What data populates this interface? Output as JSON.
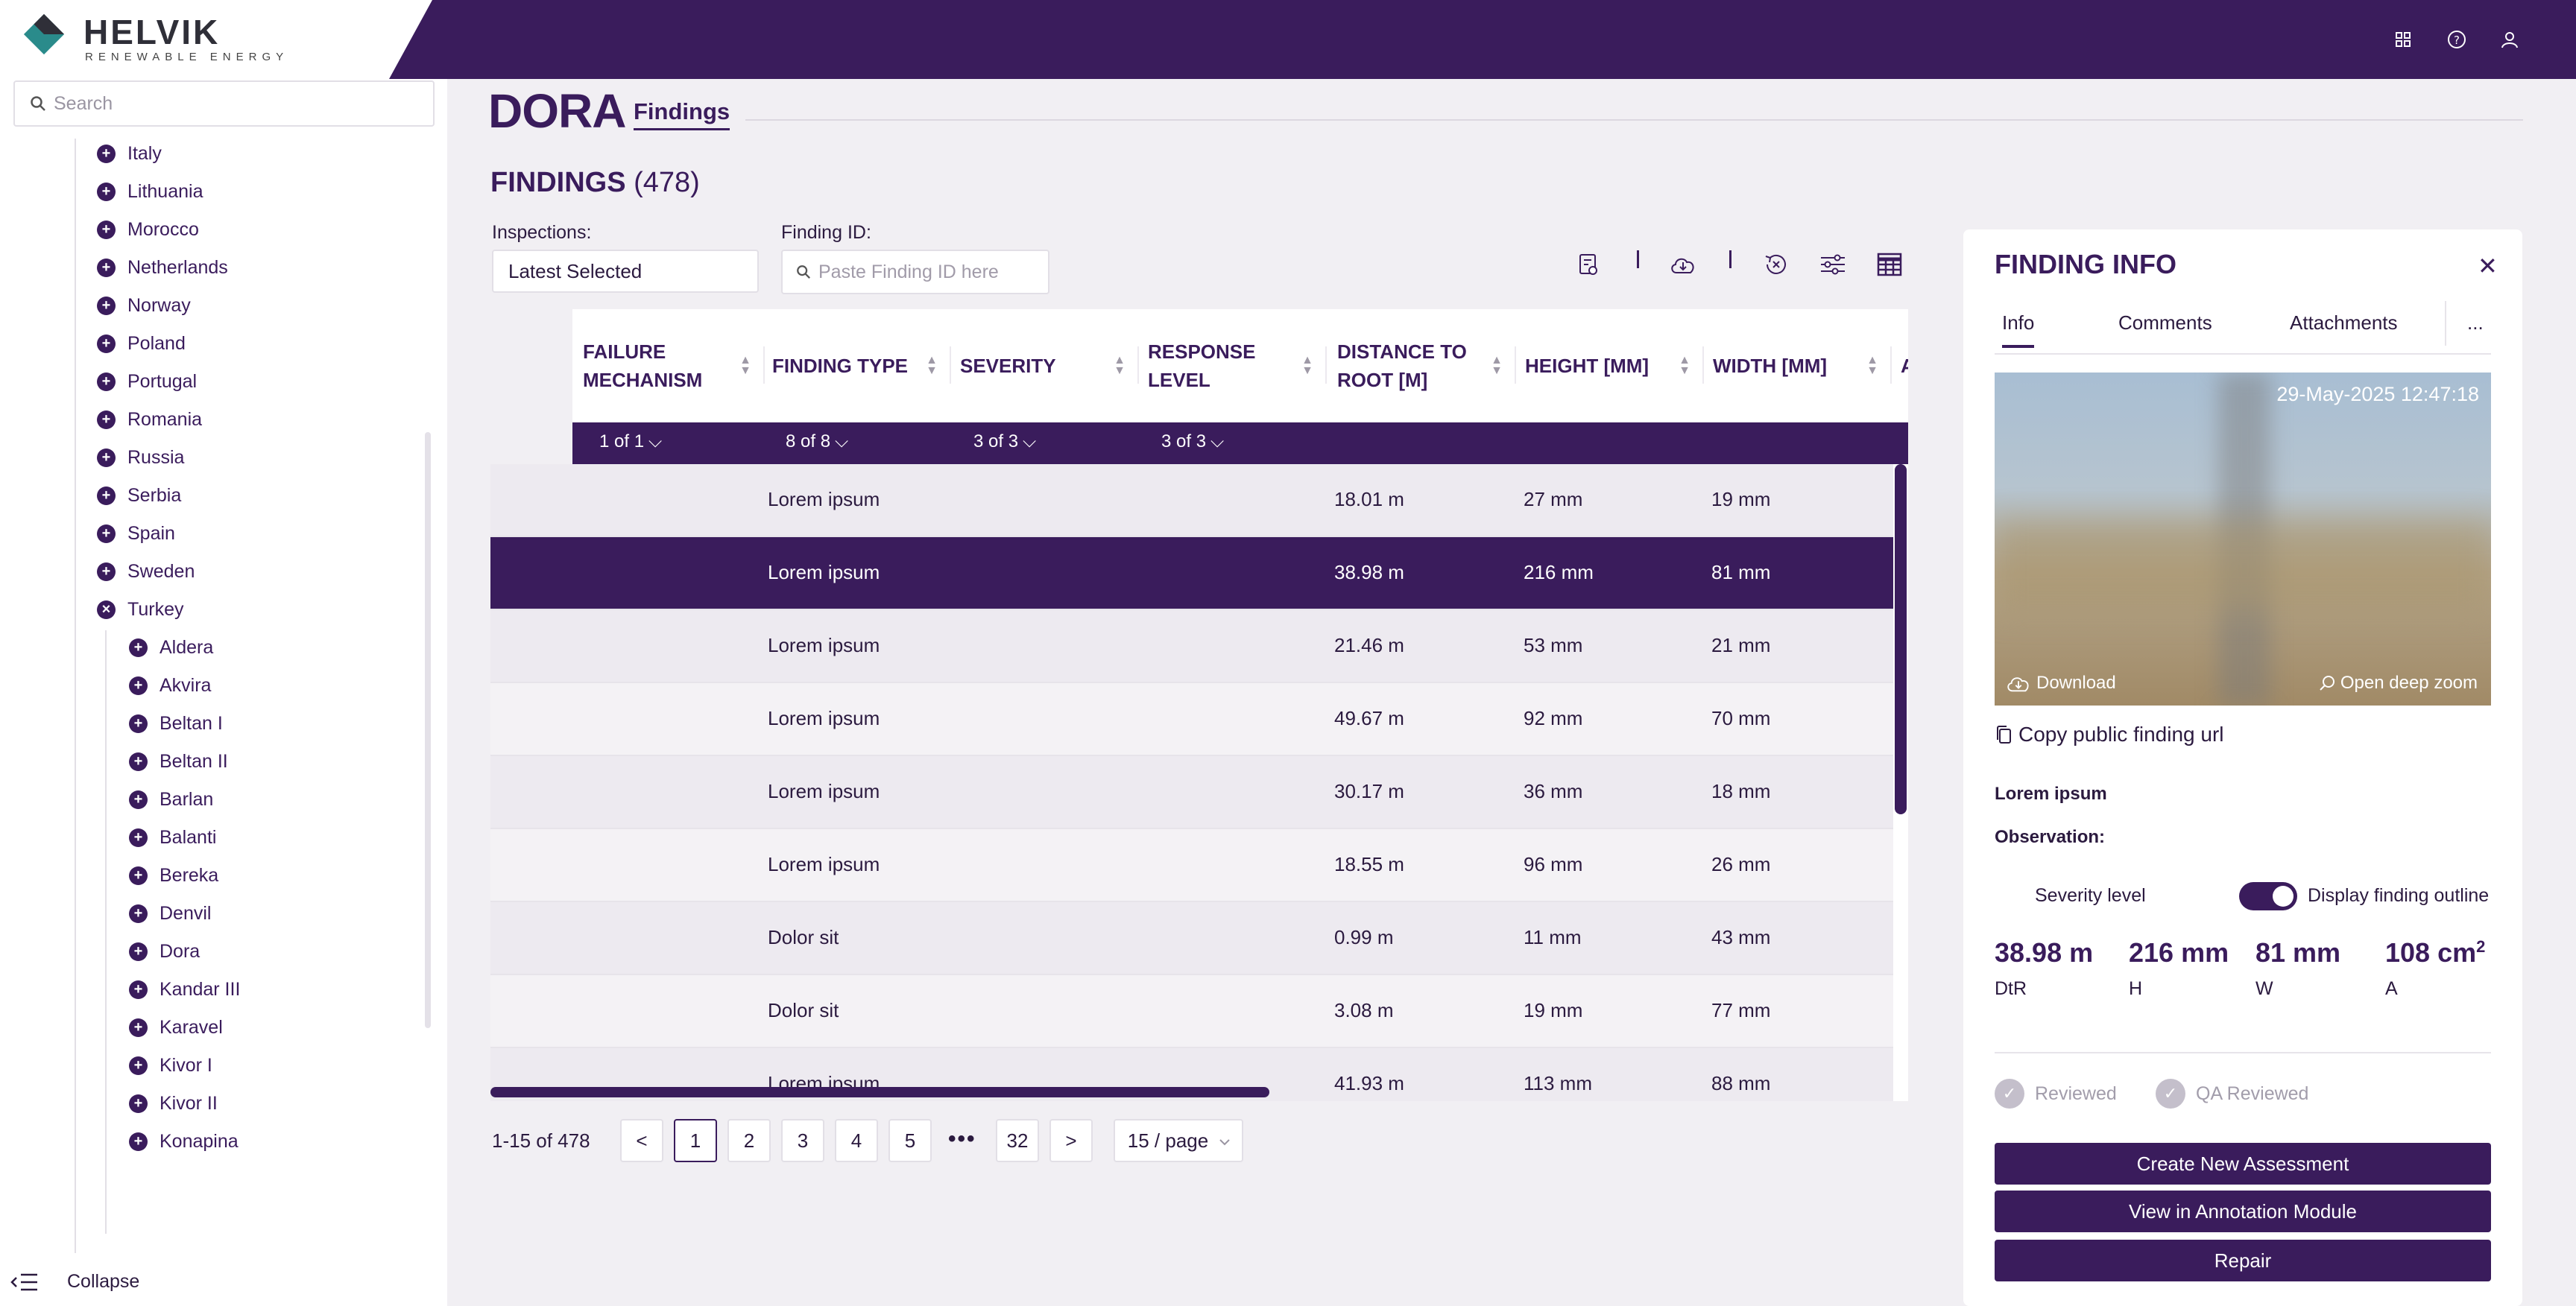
{
  "brand": {
    "name": "HELVIK",
    "tagline": "RENEWABLE ENERGY"
  },
  "colors": {
    "primary": "#3a1c5c",
    "logo_teal": "#2a8b8b",
    "background": "#f1eff3"
  },
  "top_icons": [
    "grid-icon",
    "help-icon",
    "user-icon"
  ],
  "sidebar": {
    "search_placeholder": "Search",
    "countries": [
      {
        "label": "Italy",
        "icon": "+"
      },
      {
        "label": "Lithuania",
        "icon": "+"
      },
      {
        "label": "Morocco",
        "icon": "+"
      },
      {
        "label": "Netherlands",
        "icon": "+"
      },
      {
        "label": "Norway",
        "icon": "+"
      },
      {
        "label": "Poland",
        "icon": "+"
      },
      {
        "label": "Portugal",
        "icon": "+"
      },
      {
        "label": "Romania",
        "icon": "+"
      },
      {
        "label": "Russia",
        "icon": "+"
      },
      {
        "label": "Serbia",
        "icon": "+"
      },
      {
        "label": "Spain",
        "icon": "+"
      },
      {
        "label": "Sweden",
        "icon": "+"
      },
      {
        "label": "Turkey",
        "icon": "×"
      }
    ],
    "sites": [
      {
        "label": "Aldera"
      },
      {
        "label": "Akvira"
      },
      {
        "label": "Beltan I"
      },
      {
        "label": "Beltan II"
      },
      {
        "label": "Barlan"
      },
      {
        "label": "Balanti"
      },
      {
        "label": "Bereka"
      },
      {
        "label": "Denvil"
      },
      {
        "label": "Dora"
      },
      {
        "label": "Kandar III"
      },
      {
        "label": "Karavel"
      },
      {
        "label": "Kivor I"
      },
      {
        "label": "Kivor II"
      },
      {
        "label": "Konapina"
      }
    ],
    "collapse_label": "Collapse"
  },
  "page": {
    "site_title": "DORA",
    "tab_label": "Findings",
    "findings_heading": "FINDINGS",
    "findings_count": "(478)"
  },
  "filters": {
    "inspections_label": "Inspections:",
    "inspections_value": "Latest Selected",
    "finding_id_label": "Finding ID:",
    "finding_id_placeholder": "Paste Finding ID here"
  },
  "table": {
    "columns": [
      {
        "label": "FAILURE MECHANISM",
        "filter": "1 of 1"
      },
      {
        "label": "FINDING TYPE",
        "filter": "8 of 8"
      },
      {
        "label": "SEVERITY",
        "filter": "3 of 3"
      },
      {
        "label": "RESPONSE LEVEL",
        "filter": "3 of 3"
      },
      {
        "label": "DISTANCE TO ROOT [M]",
        "filter": ""
      },
      {
        "label": "HEIGHT [MM]",
        "filter": ""
      },
      {
        "label": "WIDTH [MM]",
        "filter": ""
      },
      {
        "label": "A",
        "filter": ""
      }
    ],
    "rows": [
      {
        "type": "Lorem ipsum",
        "dtr": "18.01 m",
        "height": "27 mm",
        "width": "19 mm"
      },
      {
        "type": "Lorem ipsum",
        "dtr": "38.98 m",
        "height": "216 mm",
        "width": "81 mm"
      },
      {
        "type": "Lorem ipsum",
        "dtr": "21.46 m",
        "height": "53 mm",
        "width": "21 mm"
      },
      {
        "type": "Lorem ipsum",
        "dtr": "49.67 m",
        "height": "92 mm",
        "width": "70 mm"
      },
      {
        "type": "Lorem ipsum",
        "dtr": "30.17 m",
        "height": "36 mm",
        "width": "18 mm"
      },
      {
        "type": "Lorem ipsum",
        "dtr": "18.55 m",
        "height": "96 mm",
        "width": "26 mm"
      },
      {
        "type": "Dolor sit",
        "dtr": "0.99 m",
        "height": "11 mm",
        "width": "43 mm"
      },
      {
        "type": "Dolor sit",
        "dtr": "3.08 m",
        "height": "19 mm",
        "width": "77 mm"
      },
      {
        "type": "Lorem ipsum",
        "dtr": "41.93 m",
        "height": "113 mm",
        "width": "88 mm"
      }
    ],
    "selected_row": 1
  },
  "pagination": {
    "range_text": "1-15 of 478",
    "pages": [
      "1",
      "2",
      "3",
      "4",
      "5"
    ],
    "ellipsis": "•••",
    "last_page": "32",
    "prev": "<",
    "next": ">",
    "page_size": "15 / page",
    "current_page": "1"
  },
  "finding_info": {
    "title": "FINDING INFO",
    "tabs": [
      "Info",
      "Comments",
      "Attachments",
      "..."
    ],
    "active_tab": "Info",
    "timestamp": "29-May-2025 12:47:18",
    "download_label": "Download",
    "deep_zoom_label": "Open deep zoom",
    "copy_url_label": "Copy public finding url",
    "finding_type": "Lorem ipsum",
    "observation_label": "Observation:",
    "severity_label": "Severity level",
    "outline_label": "Display finding outline",
    "outline_enabled": true,
    "metrics": [
      {
        "value": "38.98 m",
        "label": "DtR"
      },
      {
        "value": "216 mm",
        "label": "H"
      },
      {
        "value": "81 mm",
        "label": "W"
      },
      {
        "value": "108 cm",
        "sup": "2",
        "label": "A"
      }
    ],
    "reviewed_label": "Reviewed",
    "qa_reviewed_label": "QA Reviewed",
    "buttons": [
      "Create New Assessment",
      "View in Annotation Module",
      "Repair"
    ]
  }
}
